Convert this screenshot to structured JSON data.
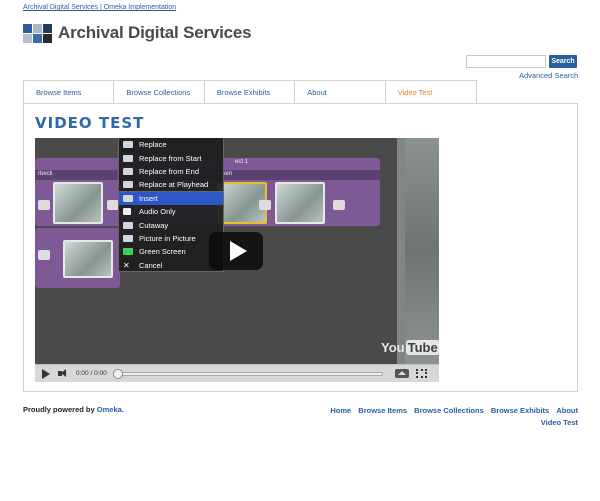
{
  "top_link": "Archival Digital Services | Omeka Implementation",
  "logo": {
    "title": "Archival Digital Services",
    "colors": [
      "#2f5d9a",
      "#a9b7c9",
      "#233b5e",
      "#b5bfcc",
      "#3b6cae",
      "#2a2a2a"
    ]
  },
  "search": {
    "value": "",
    "placeholder": "",
    "button_label": "Search",
    "advanced_label": "Advanced Search"
  },
  "nav": {
    "items": [
      {
        "label": "Browse Items"
      },
      {
        "label": "Browse Collections"
      },
      {
        "label": "Browse Exhibits"
      },
      {
        "label": "About"
      },
      {
        "label": "Video Test"
      }
    ],
    "active_index": 4
  },
  "page": {
    "title": "VIDEO TEST"
  },
  "video": {
    "context_menu": [
      "Replace",
      "Replace from Start",
      "Replace from End",
      "Replace at Playhead",
      "Insert",
      "Audio Only",
      "Cutaway",
      "Picture in Picture",
      "Green Screen",
      "Cancel"
    ],
    "highlighted_item": "Insert",
    "track_labels": [
      "rbeck",
      "ersen",
      "ect 1"
    ],
    "watermark_you": "You",
    "watermark_tube": "Tube",
    "time_display": "0:00 / 0:00",
    "progress": 0.0
  },
  "footer": {
    "powered_text": "Proudly powered by ",
    "powered_brand": "Omeka.",
    "links": [
      "Home",
      "Browse Items",
      "Browse Collections",
      "Browse Exhibits",
      "About",
      "Video Test"
    ]
  },
  "colors": {
    "link": "#2a5f9e",
    "active_tab": "#e67e22",
    "title": "#2f6aa8",
    "menu_highlight": "#2d56c6",
    "track": "#7d5a96"
  }
}
